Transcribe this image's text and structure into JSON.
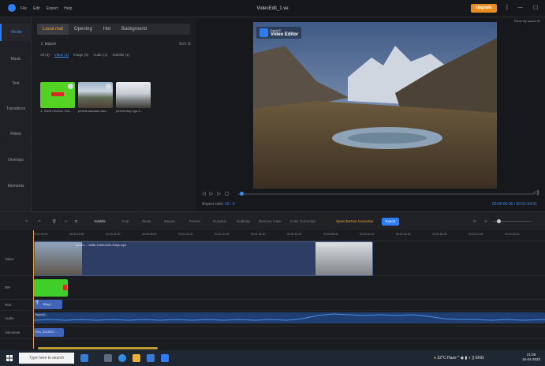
{
  "titlebar": {
    "menu": [
      "File",
      "Edit",
      "Export",
      "Help"
    ],
    "title": "VideoEdit_1.ve",
    "upgrade_label": "Upgrade",
    "minimize": "—",
    "maximize": "☐"
  },
  "leftnav": {
    "items": [
      "Media",
      "Music",
      "Text",
      "Transitions",
      "Filters",
      "Overlays",
      "Elements"
    ]
  },
  "media": {
    "tabs": [
      "Local mat",
      "Opening",
      "Hot",
      "Background"
    ],
    "import_label": "Import",
    "sort_label": "Sort",
    "filters": [
      "All (3)",
      "Video (3)",
      "Image (2)",
      "Audio (1)",
      "Subtitle (1)"
    ],
    "thumbs": [
      {
        "label": "1. Green Screen Sub..."
      },
      {
        "label": "pexels-sanatan-shu..."
      },
      {
        "label": "pexels-tiny-ngo-1..."
      }
    ]
  },
  "preview": {
    "recently_label": "Recently saved 25",
    "watermark_small": "EaseUS",
    "watermark_big": "Video Editor",
    "aspect_label": "Aspect ratio:",
    "aspect_value": "16 : 9",
    "time": "00:00:00.00 / 00:01:54.01"
  },
  "toolbar": {
    "tools": [
      "Subtitle",
      "Crop",
      "Zoom",
      "Mosaic",
      "Freeze",
      "Duration",
      "Dubbing",
      "Remove noise",
      "Color Correction",
      "Speech&Text Converter"
    ],
    "export_label": "Export"
  },
  "timeline": {
    "ticks": [
      "00:00:00.00",
      "00:00:16.00",
      "00:00:32.00",
      "00:00:48.00",
      "00:01:04.00",
      "00:01:20.00",
      "00:01:36.00",
      "00:01:52.00",
      "00:02:08.00",
      "00:02:24.00",
      "00:02:40.00",
      "00:02:56.00",
      "00:03:12.00",
      "00:03:28.00"
    ],
    "tracks": [
      "Video",
      "PIP",
      "Text",
      "Audio",
      "Voiceover"
    ],
    "video_clip_name": "pexels-...-5386-1080x1920-30fps.mp4",
    "video_clip2_name": "pexels-tiny-ngo-1...",
    "text_clip": "Blog 1",
    "audio_clip": "Bgm(1)...",
    "vo_clip": "Rec_2023091..."
  },
  "taskbar": {
    "search_placeholder": "Type here to search",
    "weather": "32°C Haze",
    "lang": "ENG",
    "time": "21:08",
    "date": "16-04-2023"
  },
  "colors": {
    "accent_blue": "#2f7df6",
    "accent_orange": "#e88c1d"
  }
}
